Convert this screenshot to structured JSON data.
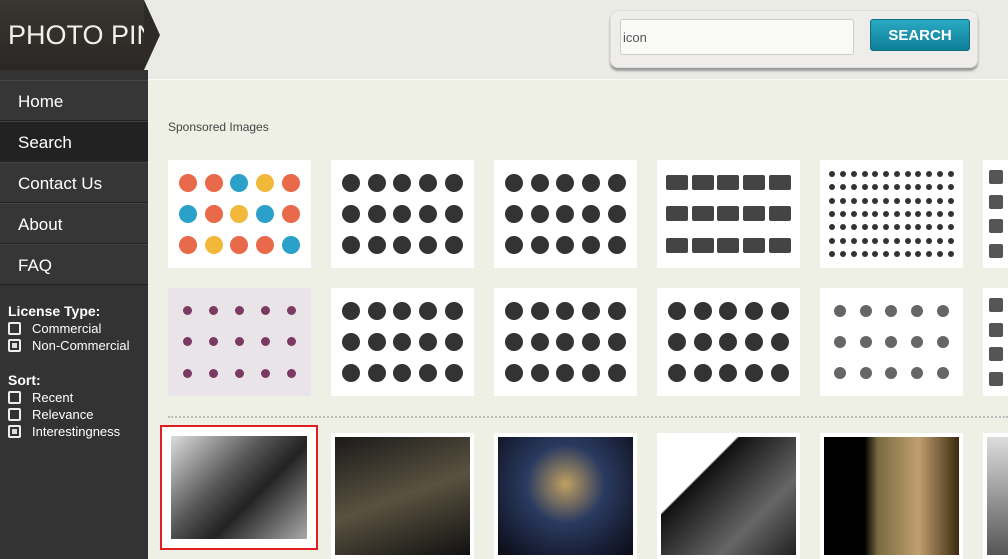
{
  "app": {
    "logo": "PHOTO PIN"
  },
  "nav": [
    {
      "label": "Home"
    },
    {
      "label": "Search",
      "active": true
    },
    {
      "label": "Contact Us"
    },
    {
      "label": "About"
    },
    {
      "label": "FAQ"
    }
  ],
  "filters": {
    "license": {
      "title": "License Type:",
      "options": [
        {
          "label": "Commercial",
          "checked": false
        },
        {
          "label": "Non-Commercial",
          "checked": true
        }
      ]
    },
    "sort": {
      "title": "Sort:",
      "options": [
        {
          "label": "Recent",
          "checked": false
        },
        {
          "label": "Relevance",
          "checked": false
        },
        {
          "label": "Interestingness",
          "checked": true
        }
      ]
    }
  },
  "search": {
    "value": "icon",
    "button": "SEARCH"
  },
  "sponsored": {
    "label": "Sponsored Images"
  },
  "colors": {
    "accent": "#1a94ad",
    "selected_border": "#e02020",
    "sidebar": "#333333"
  }
}
